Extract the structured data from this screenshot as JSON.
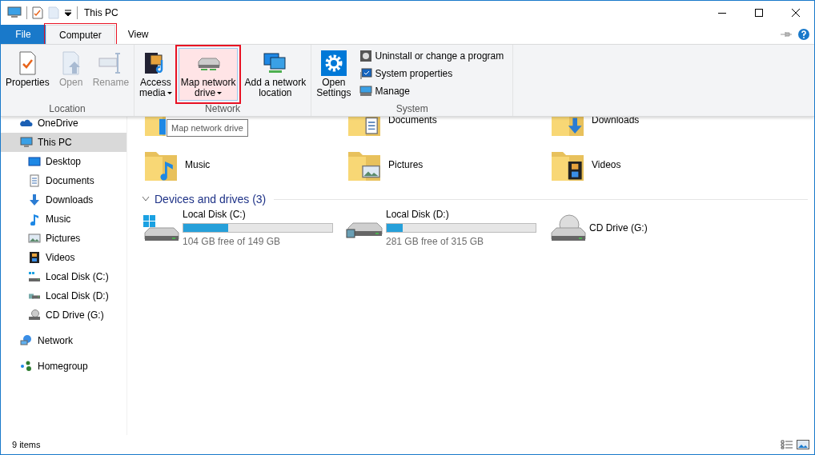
{
  "window": {
    "title": "This PC"
  },
  "tabs": [
    {
      "label": "File",
      "kind": "file",
      "selected": false,
      "highlighted": false
    },
    {
      "label": "Computer",
      "kind": "tab",
      "selected": true,
      "highlighted": true
    },
    {
      "label": "View",
      "kind": "tab",
      "selected": false,
      "highlighted": false
    }
  ],
  "ribbon": {
    "groups": [
      {
        "label": "Location",
        "items": [
          {
            "label": "Properties",
            "disabled": false,
            "dropdown": false,
            "hover": false,
            "highlighted": false
          },
          {
            "label": "Open",
            "disabled": true,
            "dropdown": false,
            "hover": false,
            "highlighted": false
          },
          {
            "label": "Rename",
            "disabled": true,
            "dropdown": false,
            "hover": false,
            "highlighted": false
          }
        ]
      },
      {
        "label": "Network",
        "items": [
          {
            "label": "Access\nmedia",
            "disabled": false,
            "dropdown": true,
            "hover": false,
            "highlighted": false
          },
          {
            "label": "Map network\ndrive",
            "disabled": false,
            "dropdown": true,
            "hover": true,
            "highlighted": true
          },
          {
            "label": "Add a network\nlocation",
            "disabled": false,
            "dropdown": false,
            "hover": false,
            "highlighted": false
          }
        ]
      },
      {
        "label": "System",
        "items": [
          {
            "label": "Open\nSettings",
            "disabled": false,
            "dropdown": false,
            "hover": false,
            "highlighted": false
          }
        ],
        "small_items": [
          {
            "label": "Uninstall or change a program"
          },
          {
            "label": "System properties"
          },
          {
            "label": "Manage"
          }
        ]
      }
    ]
  },
  "tooltip": "Map network drive",
  "nav": [
    {
      "label": "OneDrive",
      "selected": false
    },
    {
      "label": "This PC",
      "selected": true,
      "children": [
        {
          "label": "Desktop",
          "selected": false
        },
        {
          "label": "Documents",
          "selected": false
        },
        {
          "label": "Downloads",
          "selected": false
        },
        {
          "label": "Music",
          "selected": false
        },
        {
          "label": "Pictures",
          "selected": false
        },
        {
          "label": "Videos",
          "selected": false
        },
        {
          "label": "Local Disk (C:)",
          "selected": false
        },
        {
          "label": "Local Disk (D:)",
          "selected": false
        },
        {
          "label": "CD Drive (G:)",
          "selected": false
        }
      ]
    },
    {
      "label": "Network",
      "selected": false
    },
    {
      "label": "Homegroup",
      "selected": false
    }
  ],
  "folders": [
    {
      "covered": true
    },
    {
      "label": "Documents"
    },
    {
      "label": "Downloads"
    },
    {
      "label": "Music"
    },
    {
      "label": "Pictures"
    },
    {
      "label": "Videos"
    }
  ],
  "drives_section": {
    "title": "Devices and drives (3)",
    "expanded": true,
    "drives": [
      {
        "name": "Local Disk (C:)",
        "level": 0.3,
        "free": "104 GB free of 149 GB"
      },
      {
        "name": "Local Disk (D:)",
        "level": 0.11,
        "free": "281 GB free of 315 GB"
      },
      {
        "name": "CD Drive (G:)"
      }
    ]
  },
  "status_bar": {
    "count": "9 items"
  }
}
